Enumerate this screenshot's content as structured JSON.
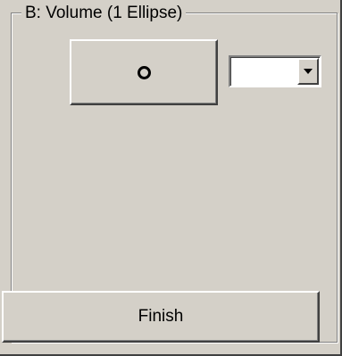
{
  "group": {
    "title": "B: Volume (1 Ellipse)"
  },
  "shape_button": {
    "icon": "ellipse-icon"
  },
  "shape_select": {
    "value": ""
  },
  "finish_button": {
    "label": "Finish"
  },
  "colors": {
    "face": "#d4d0c8",
    "shadow": "#808080",
    "dark_shadow": "#404040",
    "highlight": "#ffffff",
    "field": "#ffffff"
  }
}
